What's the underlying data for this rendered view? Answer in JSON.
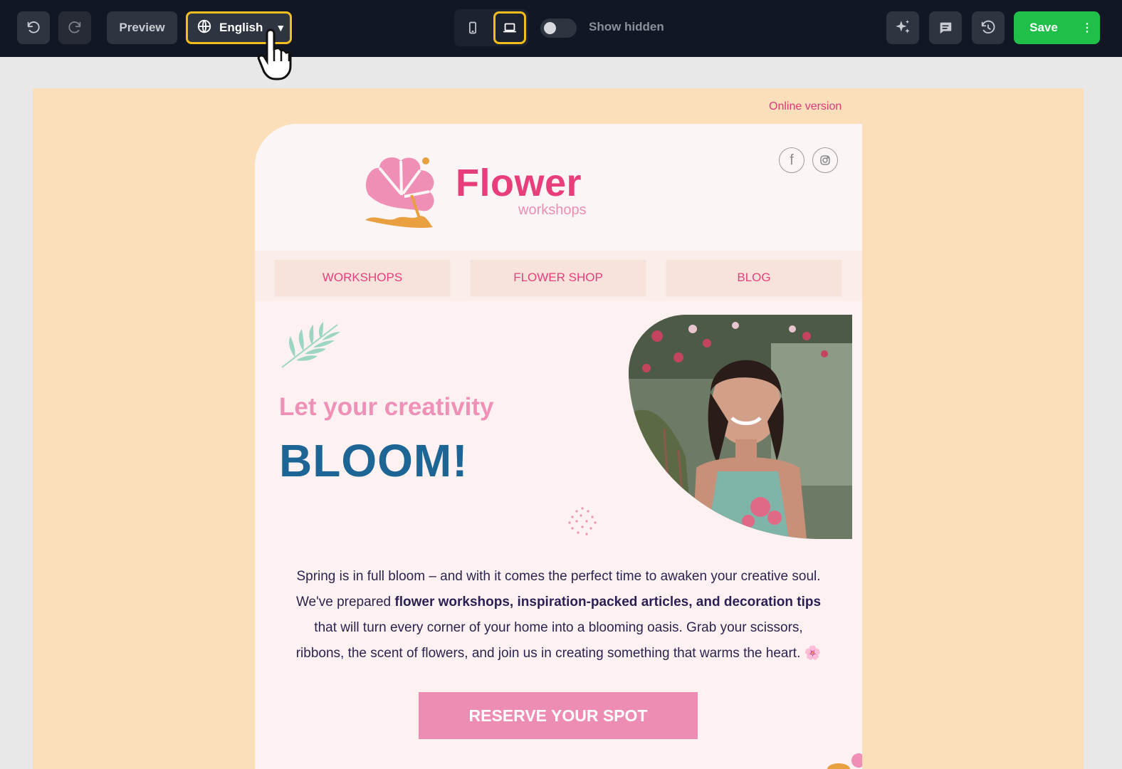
{
  "toolbar": {
    "undo_icon": "undo-icon",
    "redo_icon": "redo-icon",
    "preview_label": "Preview",
    "language_label": "English",
    "language_icon": "globe-icon",
    "devices": [
      "mobile-icon",
      "desktop-icon"
    ],
    "active_device": "desktop",
    "show_hidden_label": "Show hidden",
    "show_hidden_enabled": false,
    "actions": [
      "sparkle-icon",
      "comment-icon",
      "history-icon"
    ],
    "save_label": "Save",
    "colors": {
      "bar": "#111724",
      "highlight": "#f2bd1d",
      "save": "#1fbf4a"
    }
  },
  "email": {
    "online_version": "Online version",
    "brand": {
      "name": "Flower",
      "tagline": "workshops",
      "color": "#e83e7b"
    },
    "social": [
      "facebook-icon",
      "instagram-icon"
    ],
    "nav": [
      "WORKSHOPS",
      "FLOWER SHOP",
      "BLOG"
    ],
    "hero": {
      "line1": "Let your creativity",
      "line2": "BLOOM!"
    },
    "body": {
      "p1": "Spring is in full bloom – and with it comes the perfect time to awaken your creative soul.",
      "p2_start": "We've prepared ",
      "p2_bold": "flower workshops, inspiration-packed articles, and decoration tips",
      "p3": "that will turn every corner of your home into a blooming oasis. Grab your scissors,",
      "p4": "ribbons, the scent of flowers, and join us in creating something that warms the heart. 🌸"
    },
    "cta": "RESERVE YOUR SPOT",
    "colors": {
      "background": "#fbdfba",
      "card": "#fdf2f1",
      "pink": "#ef91b7",
      "blue": "#1d6595"
    }
  }
}
